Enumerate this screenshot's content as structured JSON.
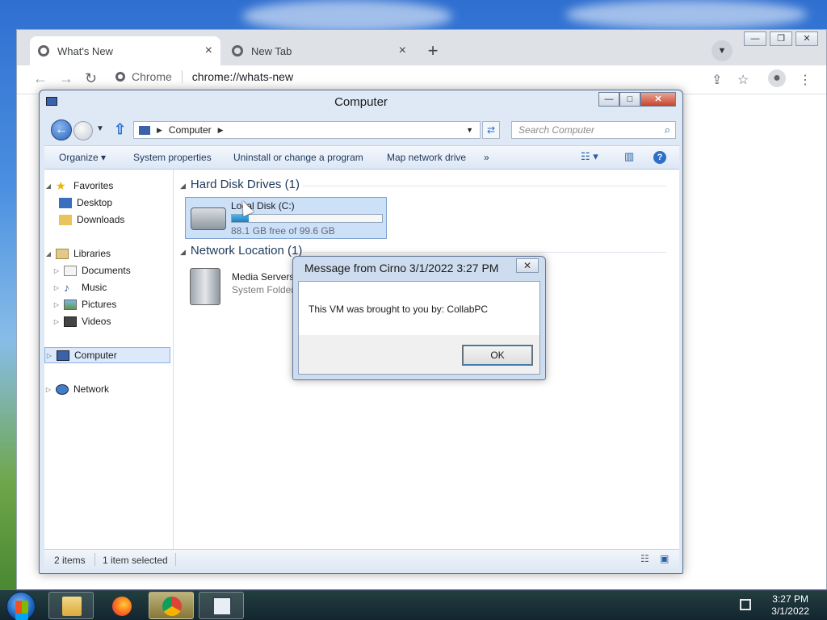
{
  "browser": {
    "tabs": [
      {
        "title": "What's New",
        "close": "×"
      },
      {
        "title": "New Tab",
        "close": "×"
      }
    ],
    "new_tab": "+",
    "omnibox": {
      "site": "Chrome",
      "url": "chrome://whats-new"
    }
  },
  "explorer": {
    "title": "Computer",
    "breadcrumb": "Computer",
    "search_placeholder": "Search Computer",
    "toolbar": {
      "organize": "Organize ▾",
      "system_properties": "System properties",
      "uninstall": "Uninstall or change a program",
      "map_drive": "Map network drive",
      "more": "»"
    },
    "nav": {
      "favorites": "Favorites",
      "desktop": "Desktop",
      "downloads": "Downloads",
      "libraries": "Libraries",
      "documents": "Documents",
      "music": "Music",
      "pictures": "Pictures",
      "videos": "Videos",
      "computer": "Computer",
      "network": "Network"
    },
    "groups": {
      "hdd": "Hard Disk Drives (1)",
      "network": "Network Location (1)"
    },
    "disk": {
      "name": "Local Disk (C:)",
      "free": "88.1 GB free of 99.6 GB",
      "used_fraction": 0.115
    },
    "media": {
      "name": "Media Servers",
      "type": "System Folder"
    },
    "status": {
      "items": "2 items",
      "selected": "1 item selected"
    }
  },
  "dialog": {
    "title": "Message from Cirno 3/1/2022 3:27 PM",
    "message": "This VM was brought to you by: CollabPC",
    "ok": "OK",
    "close": "✕"
  },
  "taskbar": {
    "time": "3:27 PM",
    "date": "3/1/2022"
  },
  "colors": {
    "accent": "#2a6fd0",
    "selection": "#cce0f8",
    "disk_bar": "#1d7fc0"
  }
}
